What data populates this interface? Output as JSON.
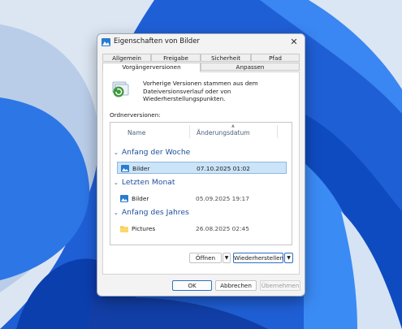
{
  "window": {
    "title": "Eigenschaften von Bilder",
    "close_glyph": "✕"
  },
  "tabs": {
    "row1": [
      {
        "label": "Allgemein"
      },
      {
        "label": "Freigabe"
      },
      {
        "label": "Sicherheit"
      },
      {
        "label": "Pfad"
      }
    ],
    "row2": [
      {
        "label": "Vorgängerversionen",
        "active": true
      },
      {
        "label": "Anpassen"
      }
    ]
  },
  "info": {
    "icon": "restore-versions-icon",
    "text": "Vorherige Versionen stammen aus dem Dateiversionsverlauf oder von Wiederherstellungspunkten."
  },
  "versions": {
    "label": "Ordnerversionen:",
    "columns": {
      "name": "Name",
      "date": "Änderungsdatum"
    },
    "groups": [
      {
        "title": "Anfang der Woche",
        "items": [
          {
            "name": "Bilder",
            "date": "07.10.2025 01:02",
            "icon": "pictures-folder-icon",
            "selected": true
          }
        ]
      },
      {
        "title": "Letzten Monat",
        "items": [
          {
            "name": "Bilder",
            "date": "05.09.2025 19:17",
            "icon": "pictures-folder-icon"
          }
        ]
      },
      {
        "title": "Anfang des Jahres",
        "items": [
          {
            "name": "Pictures",
            "date": "26.08.2025 02:45",
            "icon": "folder-icon"
          }
        ]
      }
    ]
  },
  "actions": {
    "open": "Öffnen",
    "restore": "Wiederherstellen",
    "dropdown_glyph": "▼"
  },
  "footer": {
    "ok": "OK",
    "cancel": "Abbrechen",
    "apply": "Übernehmen"
  },
  "colors": {
    "accent": "#2f6fc7",
    "selection": "#cce4f7",
    "group_header": "#1e4f9c"
  }
}
